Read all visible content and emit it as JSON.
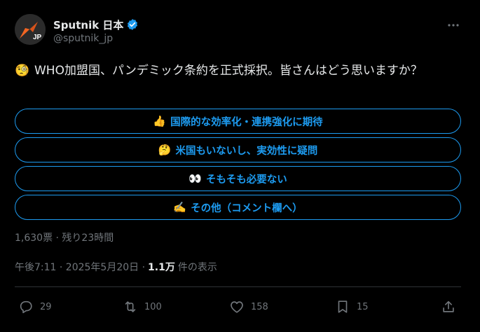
{
  "author": {
    "name": "Sputnik 日本",
    "handle": "@sputnik_jp",
    "avatar_text": "JP"
  },
  "tweet": {
    "emoji": "🧐",
    "text": "WHO加盟国、パンデミック条約を正式採択。皆さんはどう思いますか？"
  },
  "poll": {
    "options": [
      {
        "emoji": "👍",
        "label": "国際的な効率化・連携強化に期待"
      },
      {
        "emoji": "🤔",
        "label": "米国もいないし、実効性に疑問"
      },
      {
        "emoji": "👀",
        "label": "そもそも必要ない"
      },
      {
        "emoji": "✍️",
        "label": "その他（コメント欄へ）"
      }
    ],
    "meta": "1,630票 · 残り23時間"
  },
  "meta": {
    "timestamp": "午後7:11 · 2025年5月20日 ·",
    "views_count": "1.1万",
    "views_label": "件の表示"
  },
  "actions": {
    "replies": "29",
    "reposts": "100",
    "likes": "158",
    "bookmarks": "15"
  },
  "colors": {
    "accent": "#1d9bf0",
    "muted": "#71767b",
    "text": "#e7e9ea",
    "background": "#000000",
    "avatar_arrow": "#f26522"
  }
}
